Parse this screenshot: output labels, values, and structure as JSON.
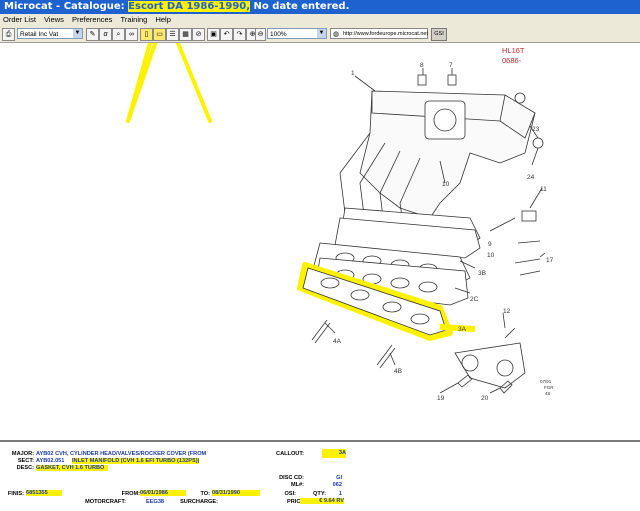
{
  "window": {
    "title": "Microcat - Catalogue: Escort DA 1986-1990, No date entered.",
    "app": "Microcat",
    "sep": " - Catalogue: ",
    "vehicle": "Escort DA 1986-1990,",
    "suffix": " No date entered."
  },
  "menu": [
    "Order List",
    "Views",
    "Preferences",
    "Training",
    "Help"
  ],
  "toolbar": {
    "price_mode": "Retail Inc Vat",
    "zoom": "100%",
    "url": "http://www.fordeurope.microcat.net",
    "gsi_label": "GSI"
  },
  "diagram": {
    "header": [
      "HL16T",
      "0686-"
    ],
    "callouts": [
      "1",
      "2C",
      "3A",
      "3B",
      "4A",
      "4B",
      "7",
      "8",
      "9",
      "10",
      "10",
      "11",
      "12",
      "17",
      "19",
      "20",
      "23",
      "24"
    ],
    "footer": [
      "07/91",
      "FGR",
      "48"
    ],
    "arrow_color": "#fff200"
  },
  "parts": {
    "major_label": "MAJOR:",
    "major_value": "AYB02  CVH, CYLINDER HEAD/VALVES/ROCKER COVER (FROM",
    "sect_label": "SECT:",
    "sect_value": "AYB02.051",
    "sect_desc": "INLET MANIFOLD (CVH 1.6 EFI TURBO (132PS))",
    "desc_label": "DESC:",
    "desc_value": "GASKET, CVH 1.6 TURBO",
    "callout_label": "CALLOUT:",
    "callout_value": "3A",
    "disc_cd_label": "DISC CD:",
    "disc_cd_value": "GI",
    "ml_label": "ML#:",
    "ml_value": "062",
    "finis_label": "FINIS:",
    "finis_value": "6851355",
    "from_label": "FROM:",
    "from_value": "06/01/1986",
    "to_label": "TO:",
    "to_value": "08/31/1990",
    "osi_label": "OSI:",
    "qty_label": "QTY:",
    "qty_value": "1",
    "motorcraft_label": "MOTORCRAFT:",
    "motorcraft_value": "EEG38",
    "surcharge_label": "SURCHARGE:",
    "price_label": "PRICE:",
    "price_value": "€ 9.64 RV"
  }
}
